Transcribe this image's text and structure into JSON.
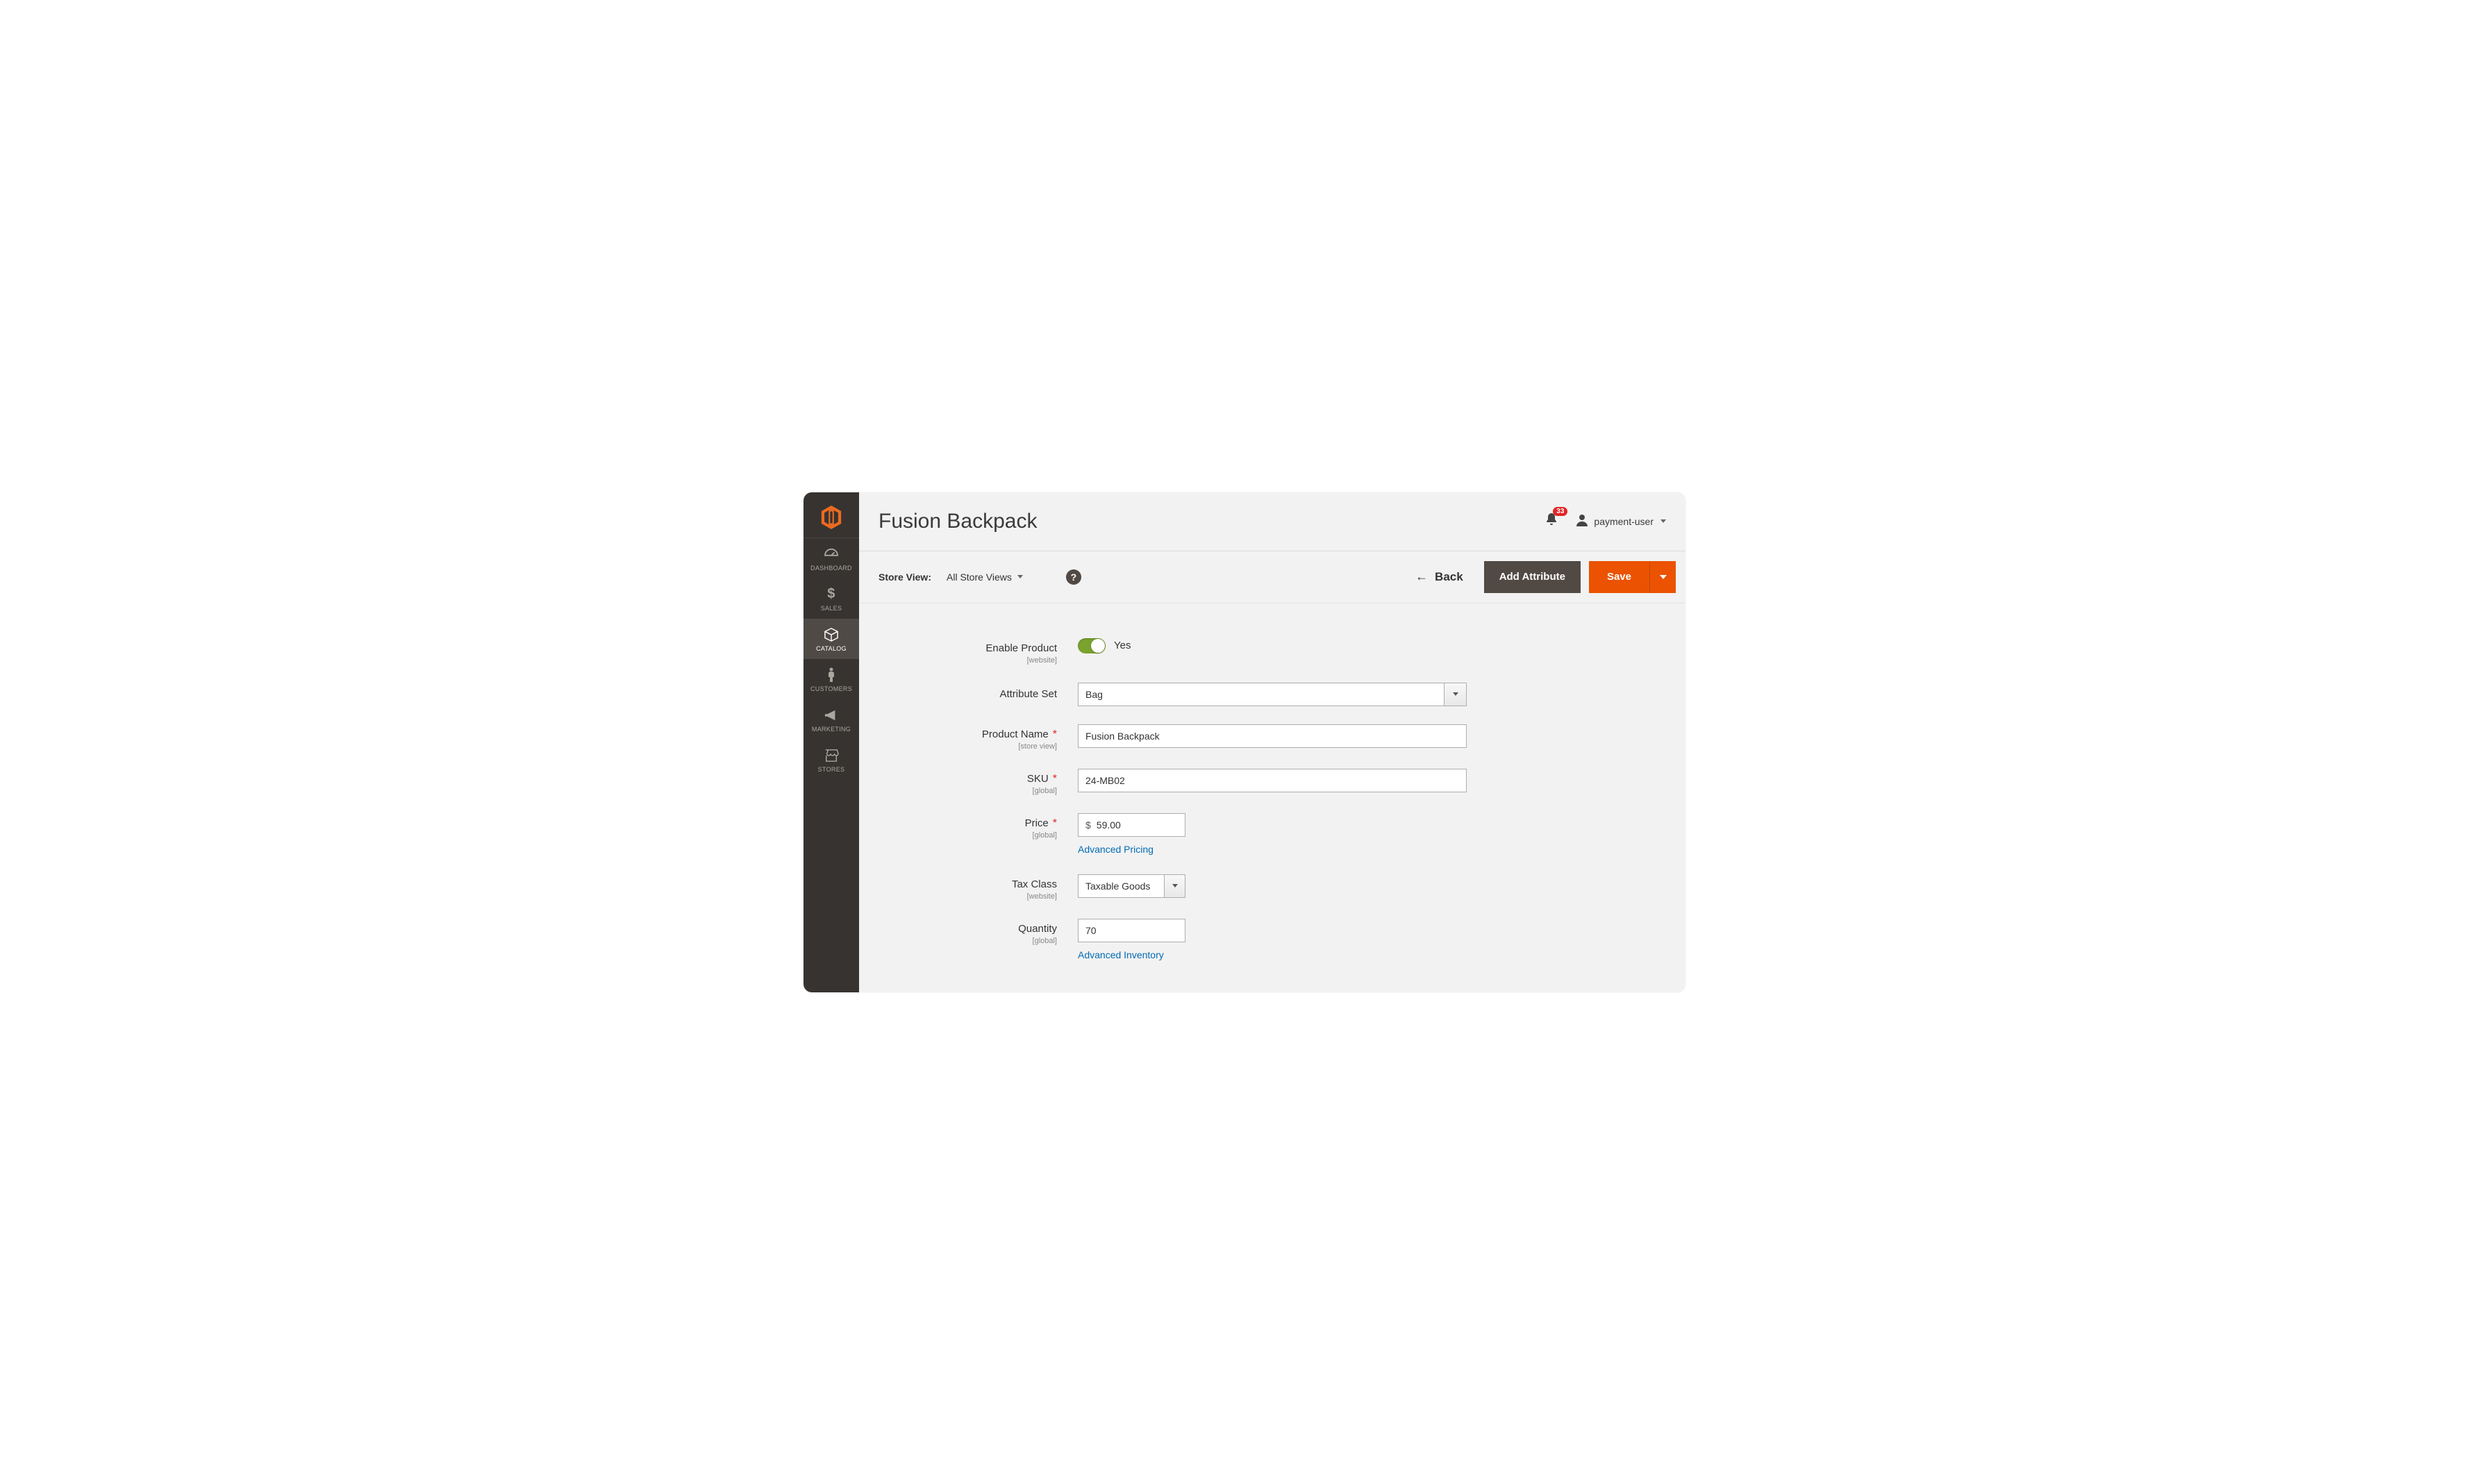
{
  "sidebar": {
    "items": [
      {
        "label": "DASHBOARD"
      },
      {
        "label": "SALES"
      },
      {
        "label": "CATALOG"
      },
      {
        "label": "CUSTOMERS"
      },
      {
        "label": "MARKETING"
      },
      {
        "label": "STORES"
      }
    ]
  },
  "header": {
    "page_title": "Fusion Backpack",
    "notification_count": "33",
    "account_name": "payment-user"
  },
  "toolbar": {
    "store_view_label": "Store View:",
    "store_view_value": "All Store Views",
    "back_label": "Back",
    "add_attribute_label": "Add Attribute",
    "save_label": "Save"
  },
  "form": {
    "enable_product": {
      "label": "Enable Product",
      "scope": "[website]",
      "value_text": "Yes"
    },
    "attribute_set": {
      "label": "Attribute Set",
      "value": "Bag"
    },
    "product_name": {
      "label": "Product Name",
      "scope": "[store view]",
      "value": "Fusion Backpack"
    },
    "sku": {
      "label": "SKU",
      "scope": "[global]",
      "value": "24-MB02"
    },
    "price": {
      "label": "Price",
      "scope": "[global]",
      "currency": "$",
      "value": "59.00",
      "advanced_link": "Advanced Pricing"
    },
    "tax_class": {
      "label": "Tax Class",
      "scope": "[website]",
      "value": "Taxable Goods"
    },
    "quantity": {
      "label": "Quantity",
      "scope": "[global]",
      "value": "70",
      "advanced_link": "Advanced Inventory"
    }
  }
}
